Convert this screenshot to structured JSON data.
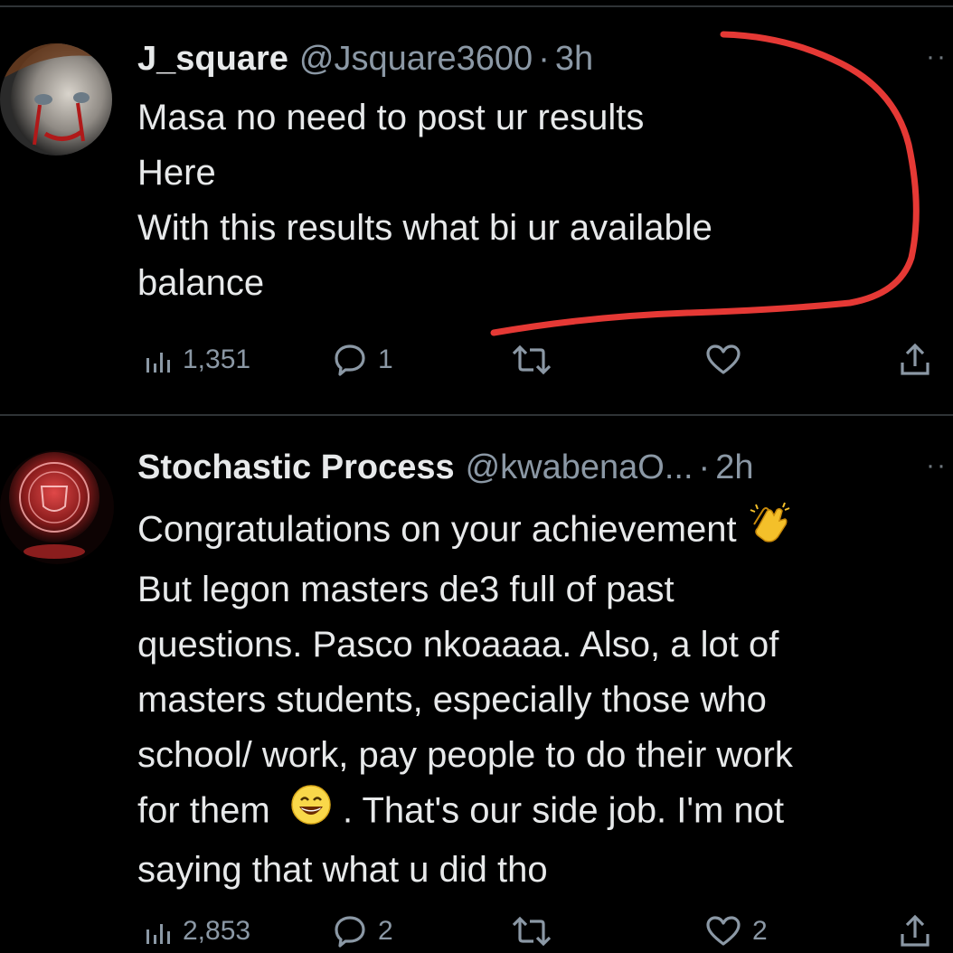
{
  "colors": {
    "background": "#000000",
    "text_primary": "#e7e9ea",
    "text_secondary": "#8b98a5",
    "divider": "#2f3336",
    "annotation_stroke": "#e53935"
  },
  "tweets": [
    {
      "display_name": "J_square",
      "handle": "@Jsquare3600",
      "separator": "·",
      "time": "3h",
      "more": "··",
      "lines": [
        "Masa no need to post ur results",
        "Here",
        "With this results what bi ur available",
        "balance"
      ],
      "views": "1,351",
      "replies": "1",
      "retweets": "",
      "likes": ""
    },
    {
      "display_name": "Stochastic Process",
      "handle": "@kwabenaO...",
      "separator": "·",
      "time": "2h",
      "more": "··",
      "lines": [
        "Congratulations on your achievement",
        "But legon masters de3 full of past",
        "questions.  Pasco nkoaaaa. Also, a lot of",
        "masters students, especially those who",
        "school/ work, pay people to do their work",
        "for them",
        ".  That's our side job. I'm not",
        "saying that what u did tho"
      ],
      "views": "2,853",
      "replies": "2",
      "retweets": "",
      "likes": "2"
    }
  ],
  "icons": {
    "views": "bar-chart-icon",
    "reply": "reply-bubble-icon",
    "retweet": "retweet-icon",
    "like": "heart-icon",
    "share": "share-icon",
    "clap_emoji": "clapping-hands-emoji",
    "grin_emoji": "grinning-face-emoji"
  }
}
